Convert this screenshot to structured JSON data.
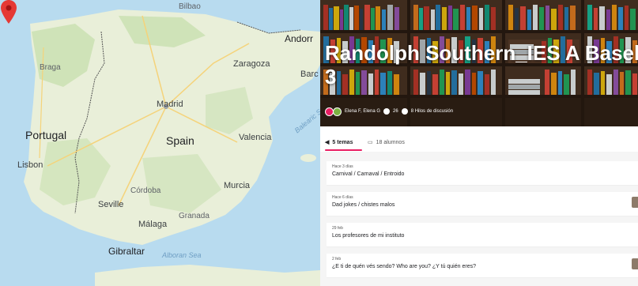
{
  "map": {
    "countries": {
      "portugal": "Portugal",
      "spain": "Spain",
      "andorra": "Andorr",
      "gibraltar": "Gibraltar"
    },
    "cities": {
      "bilbao": "Bilbao",
      "zaragoza": "Zaragoza",
      "madrid": "Madrid",
      "valencia": "Valencia",
      "lisbon": "Lisbon",
      "seville": "Seville",
      "malaga": "Málaga",
      "murcia": "Murcia",
      "braga": "Braga",
      "cordoba": "Córdoba",
      "granada": "Granada",
      "barcelona": "Barc"
    },
    "seas": {
      "alboran": "Alboran Sea",
      "balearic": "Balearic Sea"
    },
    "colors": {
      "water": "#b8dbef",
      "land": "#e9efd9",
      "green": "#cfe3b8",
      "pin": "#e53935"
    }
  },
  "hero": {
    "title_line1": "Randolph Southern_IES A Basel",
    "title_line2": "3",
    "authors": "Elena F, Elena G",
    "count": "26",
    "threads": "8 Hilos de discusión"
  },
  "tabs": [
    {
      "label": "5 temas",
      "icon": "megaphone-icon"
    },
    {
      "label": "18 alumnos",
      "icon": "students-icon"
    }
  ],
  "topics": [
    {
      "date": "Hace 3 días",
      "title": "Carnival / Carnaval / Entroido"
    },
    {
      "date": "Hace 6 días",
      "title": "Dad jokes / chistes malos"
    },
    {
      "date": "29 feb",
      "title": "Los profesores de mi instituto"
    },
    {
      "date": "2 feb",
      "title": "¿E ti de quén vés sendo? Who are you? ¿Y tú quién eres?"
    }
  ],
  "accent": "#e91e63"
}
